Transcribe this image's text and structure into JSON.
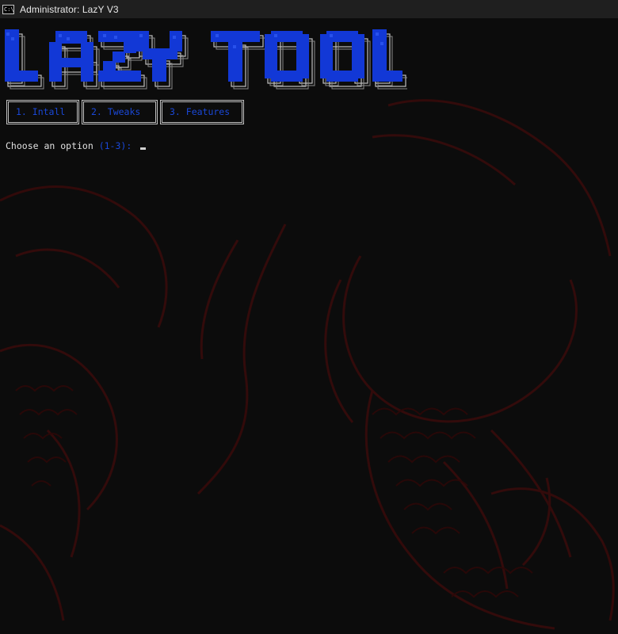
{
  "window": {
    "title": "Administrator:  LazY V3",
    "icon": "console-icon",
    "icon_glyph": "C:\\"
  },
  "colors": {
    "background": "#0c0c0c",
    "titlebar": "#1f1f1f",
    "accent_blue": "#1a48d8",
    "logo_blue": "#1238d6",
    "dragon_red": "#3a0a0a",
    "text": "#e0e0e0"
  },
  "logo": {
    "text": "LAZY TOOL"
  },
  "menu": {
    "items": [
      {
        "label": "1. Intall"
      },
      {
        "label": "2. Tweaks"
      },
      {
        "label": "3. Features"
      }
    ]
  },
  "prompt": {
    "text": "Choose an option ",
    "range": "(1-3)",
    "colon": ": "
  }
}
